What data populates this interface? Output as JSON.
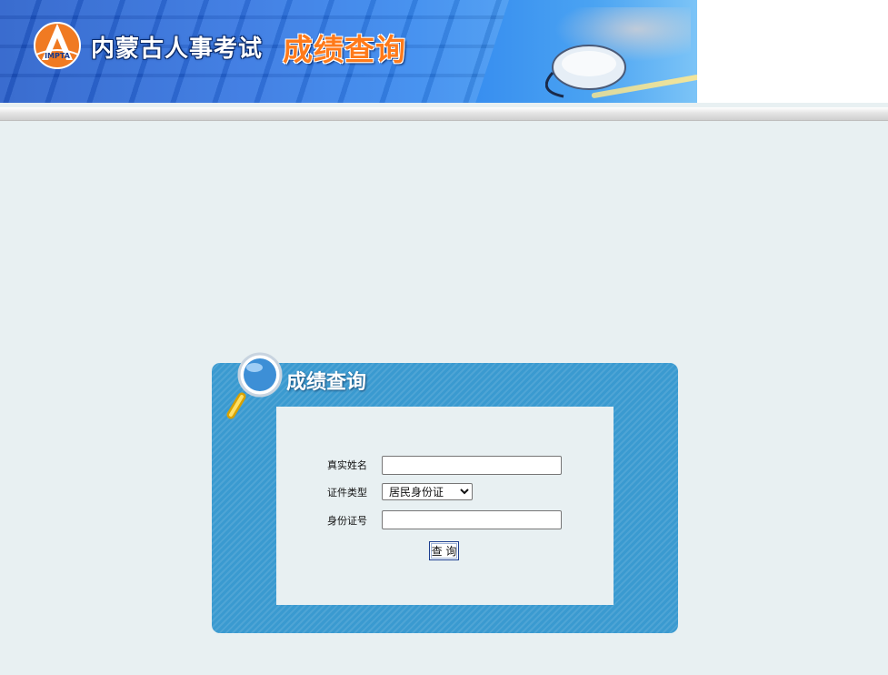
{
  "header": {
    "org_title": "内蒙古人事考试",
    "page_title": "成绩查询",
    "logo_text": "IMPTA"
  },
  "panel": {
    "title": "成绩查询"
  },
  "form": {
    "name_label": "真实姓名",
    "name_value": "",
    "id_type_label": "证件类型",
    "id_type_selected": "居民身份证",
    "id_number_label": "身份证号",
    "id_number_value": "",
    "submit_label": "查 询"
  },
  "colors": {
    "page_background": "#e8f0f2",
    "panel_blue": "#3a9ad0",
    "title_orange": "#ff7a1a"
  }
}
